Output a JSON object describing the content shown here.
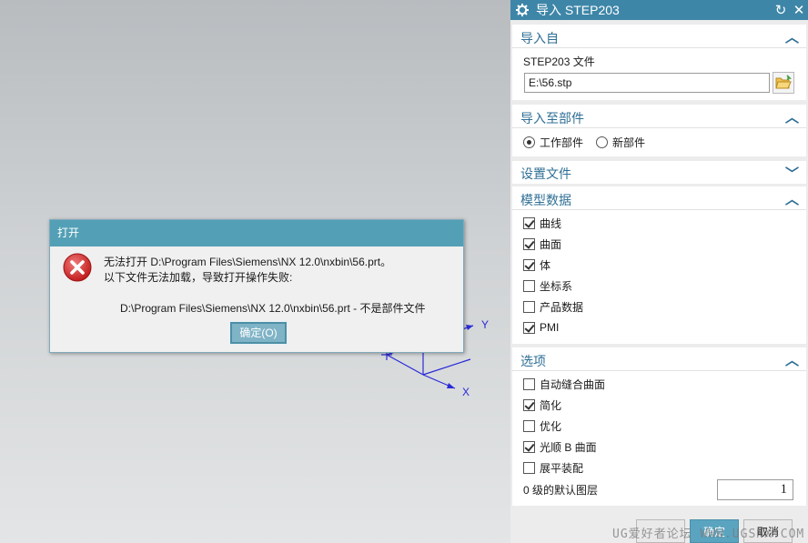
{
  "viewport": {
    "axis_y": "Y",
    "axis_x": "X"
  },
  "error_dialog": {
    "title": "打开",
    "line1": "无法打开 D:\\Program Files\\Siemens\\NX 12.0\\nxbin\\56.prt。",
    "line2": "以下文件无法加载，导致打开操作失败:",
    "line3": "D:\\Program Files\\Siemens\\NX 12.0\\nxbin\\56.prt - 不是部件文件",
    "ok_label": "确定(O)"
  },
  "panel": {
    "title": "导入 STEP203",
    "reset_icon": "↻",
    "close_icon": "✕",
    "import_from": {
      "title": "导入自",
      "file_label": "STEP203 文件",
      "file_value": "E:\\56.stp"
    },
    "import_to": {
      "title": "导入至部件",
      "options": [
        {
          "label": "工作部件",
          "selected": true
        },
        {
          "label": "新部件",
          "selected": false
        }
      ]
    },
    "settings_file": {
      "title": "设置文件"
    },
    "model_data": {
      "title": "模型数据",
      "items": [
        {
          "label": "曲线",
          "checked": true
        },
        {
          "label": "曲面",
          "checked": true
        },
        {
          "label": "体",
          "checked": true
        },
        {
          "label": "坐标系",
          "checked": false
        },
        {
          "label": "产品数据",
          "checked": false
        },
        {
          "label": "PMI",
          "checked": true
        }
      ]
    },
    "options": {
      "title": "选项",
      "items": [
        {
          "label": "自动缝合曲面",
          "checked": false
        },
        {
          "label": "简化",
          "checked": true
        },
        {
          "label": "优化",
          "checked": false
        },
        {
          "label": "光顺 B 曲面",
          "checked": true
        },
        {
          "label": "展平装配",
          "checked": false
        }
      ],
      "layer_label": "0 级的默认图层",
      "layer_value": "1"
    },
    "buttons": {
      "apply": "确定",
      "cancel": "取消"
    }
  },
  "watermark": "UG爱好者论坛 WWW.UGSNX.COM",
  "colors": {
    "title_bar": "#3e86a8",
    "section_title": "#2f6f95",
    "error_red": "#d63a3a"
  }
}
